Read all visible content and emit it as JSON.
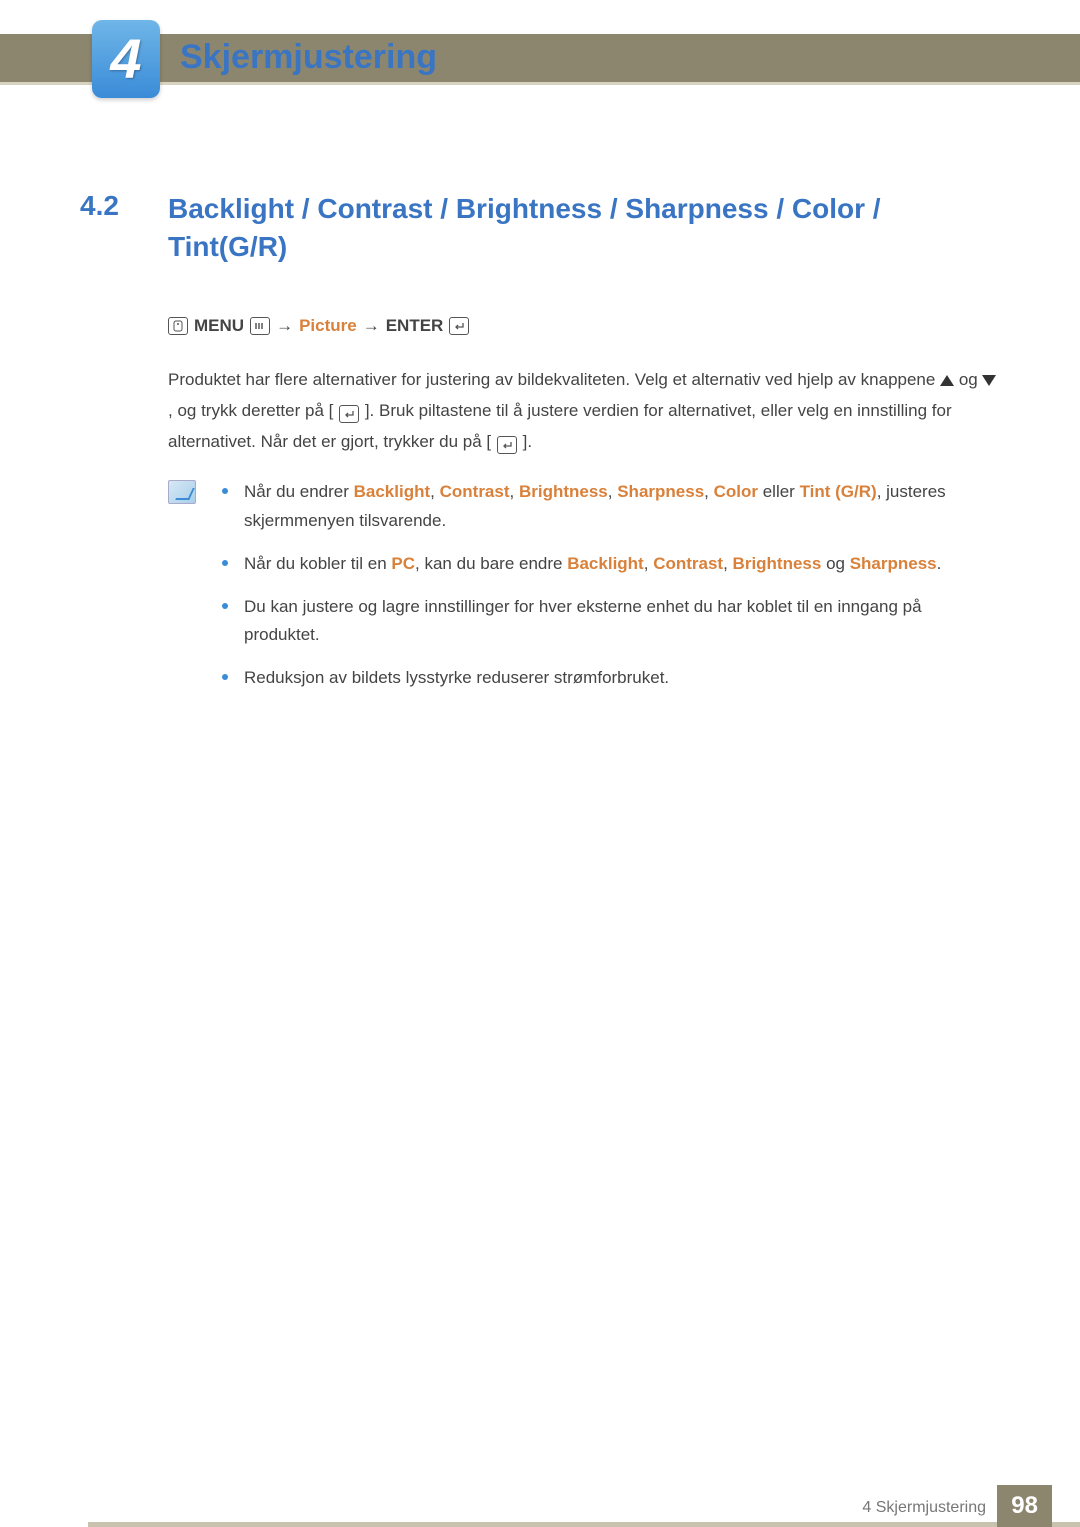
{
  "chapter": {
    "number": "4",
    "title": "Skjermjustering"
  },
  "section": {
    "number": "4.2",
    "title": "Backlight / Contrast / Brightness / Sharpness / Color / Tint(G/R)"
  },
  "nav": {
    "menu": "MENU",
    "arrow": "→",
    "picture": "Picture",
    "enter": "ENTER"
  },
  "body": {
    "p1a": "Produktet har flere alternativer for justering av bildekvaliteten. Velg et alternativ ved hjelp av knappene ",
    "p1b": " og ",
    "p1c": ", og trykk deretter på [",
    "p1d": "]. Bruk piltastene til å justere verdien for alternativet, eller velg en innstilling for alternativet. Når det er gjort, trykker du på [",
    "p1e": "]."
  },
  "notes": {
    "n1a": "Når du endrer ",
    "n1_backlight": "Backlight",
    "n1_sep": ", ",
    "n1_contrast": "Contrast",
    "n1_brightness": "Brightness",
    "n1_sharpness": "Sharpness",
    "n1_color": "Color",
    "n1_eller": " eller ",
    "n1_tint": "Tint (G/R)",
    "n1b": ", justeres skjermmenyen tilsvarende.",
    "n2a": "Når du kobler til en ",
    "n2_pc": "PC",
    "n2b": ", kan du bare endre ",
    "n2_og": " og ",
    "n2c": ".",
    "n3": "Du kan justere og lagre innstillinger for hver eksterne enhet du har koblet til en inngang på produktet.",
    "n4": "Reduksjon av bildets lysstyrke reduserer strømforbruket."
  },
  "footer": {
    "label": "4 Skjermjustering",
    "page": "98"
  }
}
